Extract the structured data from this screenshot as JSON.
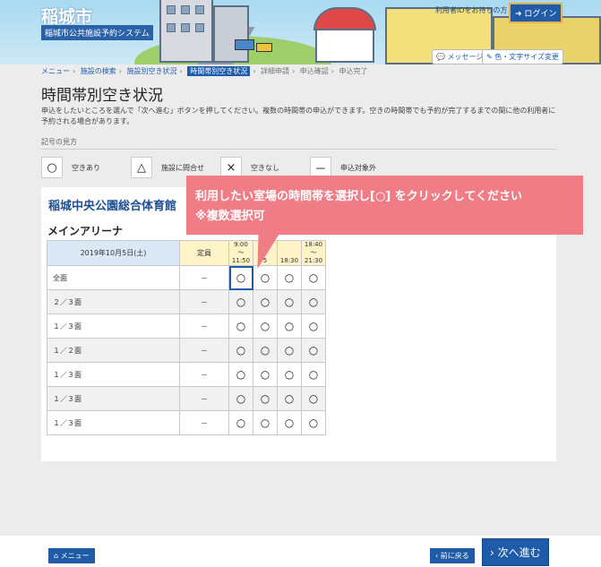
{
  "header": {
    "city_name": "稲城市",
    "system_name": "稲城市公共施設予約システム",
    "login_note": "利用者IDをお持ちの方",
    "login_label": "ログイン",
    "message_label": "メッセージ",
    "font_label": "色・文字サイズ変更"
  },
  "breadcrumb": [
    "メニュー",
    "施設の検索",
    "施設別空き状況",
    "時間帯別空き状況",
    "詳細申請",
    "申込確認",
    "申込完了"
  ],
  "page": {
    "title": "時間帯別空き状況",
    "intro": "申込をしたいところを選んで「次へ進む」ボタンを押してください。複数の時間帯の申込ができます。空きの時間帯でも予約が完了するまでの間に他の利用者に予約される場合があります。",
    "legend_heading": "記号の見方"
  },
  "legend": [
    {
      "symbol": "○",
      "label": "空きあり"
    },
    {
      "symbol": "△",
      "label": "施設に問合せ"
    },
    {
      "symbol": "×",
      "label": "空きなし"
    },
    {
      "symbol": "－",
      "label": "申込対象外"
    }
  ],
  "facility": {
    "name": "稲城中央公園総合体育館",
    "room": "メインアリーナ",
    "date": "2019年10月5日(土)",
    "capacity_header": "定員",
    "slots": [
      {
        "start": "9:00",
        "tilde": "～",
        "end": "11:50"
      },
      {
        "start": "12:",
        "tilde": "～",
        "end": "5"
      },
      {
        "start": "",
        "tilde": "",
        "end": "18:30"
      },
      {
        "start": "18:40",
        "tilde": "～",
        "end": "21:30"
      }
    ],
    "rows": [
      {
        "area": "全面",
        "capacity": "－",
        "cells": [
          "○",
          "○",
          "○",
          "○"
        ]
      },
      {
        "area": "２／３面",
        "capacity": "－",
        "cells": [
          "○",
          "○",
          "○",
          "○"
        ]
      },
      {
        "area": "１／３面",
        "capacity": "－",
        "cells": [
          "○",
          "○",
          "○",
          "○"
        ]
      },
      {
        "area": "１／２面",
        "capacity": "－",
        "cells": [
          "○",
          "○",
          "○",
          "○"
        ]
      },
      {
        "area": "１／３面",
        "capacity": "－",
        "cells": [
          "○",
          "○",
          "○",
          "○"
        ]
      },
      {
        "area": "１／３面",
        "capacity": "－",
        "cells": [
          "○",
          "○",
          "○",
          "○"
        ]
      },
      {
        "area": "１／３面",
        "capacity": "－",
        "cells": [
          "○",
          "○",
          "○",
          "○"
        ]
      }
    ]
  },
  "callout": {
    "line1": "利用したい室場の時間帯を選択し[○] をクリックしてください",
    "line2": "※複数選択可"
  },
  "footer": {
    "menu_label": "メニュー",
    "back_label": "前に戻る",
    "next_label": "次へ進む"
  }
}
